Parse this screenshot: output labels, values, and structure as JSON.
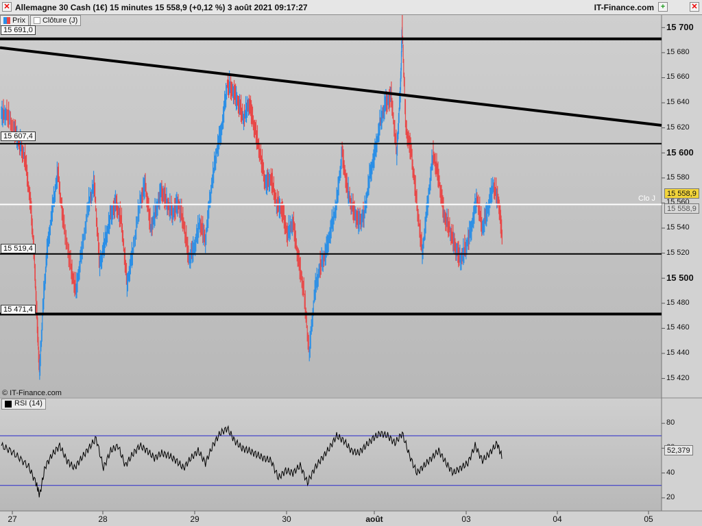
{
  "header": {
    "title": "Allemagne 30 Cash (1€) 15 minutes 15 558,9 (+0,12 %) 3 août 2021 09:17:27",
    "brand": "IT-Finance.com",
    "close_symbol": "✕",
    "add_symbol": "+"
  },
  "legend": [
    {
      "label": "Prix",
      "color": "#e03030"
    },
    {
      "label": "Clôture (J)",
      "color": "#ffffff"
    }
  ],
  "level_tags": [
    "15 691,0",
    "15 607,4",
    "15 519,4",
    "15 471,4"
  ],
  "closing_label": "Clo J",
  "last_price": "15 558,9",
  "close_price": "15 558,9",
  "copyright": "© IT-Finance.com",
  "rsi_label": "RSI (14)",
  "rsi_value": "52,379",
  "colors": {
    "background": "#c9c9c9",
    "up": "#2b8fe6",
    "down": "#e84848",
    "closing_line": "#ffffff",
    "rsi_bands": "#2828cc",
    "last_price_box": "#f2d43a"
  },
  "chart_data": {
    "type": "line",
    "price_axis": {
      "range": [
        15405,
        15710
      ],
      "ticks": [
        15420,
        15440,
        15460,
        15480,
        15500,
        15520,
        15540,
        15560,
        15580,
        15600,
        15620,
        15640,
        15660,
        15680,
        15700
      ],
      "tick_labels": [
        "15 420",
        "15 440",
        "15 460",
        "15 480",
        "15 500",
        "15 520",
        "15 540",
        "15 560",
        "15 580",
        "15 600",
        "15 620",
        "15 640",
        "15 660",
        "15 680",
        "15 700"
      ],
      "major": [
        "15 500",
        "15 600",
        "15 700"
      ]
    },
    "x_axis": {
      "labels": [
        "27",
        "28",
        "29",
        "30",
        "août",
        "03",
        "04",
        "05"
      ],
      "major": [
        "août"
      ]
    },
    "levels": [
      15691.0,
      15607.4,
      15519.4,
      15471.4
    ],
    "closing_level": 15558.9,
    "trendline": {
      "from": [
        0,
        15684
      ],
      "to": [
        1,
        15622
      ]
    },
    "price_series": [
      [
        0,
        15630
      ],
      [
        0.3,
        15632
      ],
      [
        0.7,
        15618
      ],
      [
        1,
        15608
      ],
      [
        1.3,
        15596
      ],
      [
        1.6,
        15560
      ],
      [
        1.8,
        15520
      ],
      [
        1.95,
        15470
      ],
      [
        2.1,
        15425
      ],
      [
        2.3,
        15480
      ],
      [
        2.5,
        15520
      ],
      [
        2.8,
        15555
      ],
      [
        3.1,
        15585
      ],
      [
        3.4,
        15545
      ],
      [
        3.8,
        15510
      ],
      [
        4.1,
        15490
      ],
      [
        4.4,
        15520
      ],
      [
        4.8,
        15560
      ],
      [
        5.1,
        15575
      ],
      [
        5.4,
        15510
      ],
      [
        5.7,
        15530
      ],
      [
        6.0,
        15550
      ],
      [
        6.3,
        15560
      ],
      [
        6.6,
        15545
      ],
      [
        6.9,
        15495
      ],
      [
        7.2,
        15520
      ],
      [
        7.6,
        15560
      ],
      [
        7.9,
        15575
      ],
      [
        8.2,
        15540
      ],
      [
        8.5,
        15555
      ],
      [
        8.8,
        15570
      ],
      [
        9.1,
        15560
      ],
      [
        9.4,
        15552
      ],
      [
        9.7,
        15560
      ],
      [
        10.0,
        15545
      ],
      [
        10.3,
        15515
      ],
      [
        10.6,
        15525
      ],
      [
        10.9,
        15545
      ],
      [
        11.2,
        15530
      ],
      [
        11.5,
        15570
      ],
      [
        11.8,
        15600
      ],
      [
        12.1,
        15620
      ],
      [
        12.4,
        15655
      ],
      [
        12.7,
        15650
      ],
      [
        13.0,
        15640
      ],
      [
        13.3,
        15628
      ],
      [
        13.6,
        15640
      ],
      [
        13.9,
        15620
      ],
      [
        14.2,
        15600
      ],
      [
        14.5,
        15575
      ],
      [
        14.8,
        15580
      ],
      [
        15.1,
        15560
      ],
      [
        15.4,
        15555
      ],
      [
        15.7,
        15535
      ],
      [
        16.0,
        15545
      ],
      [
        16.3,
        15515
      ],
      [
        16.6,
        15490
      ],
      [
        16.9,
        15440
      ],
      [
        17.2,
        15490
      ],
      [
        17.5,
        15510
      ],
      [
        17.8,
        15520
      ],
      [
        18.1,
        15540
      ],
      [
        18.4,
        15560
      ],
      [
        18.7,
        15600
      ],
      [
        19.0,
        15570
      ],
      [
        19.3,
        15555
      ],
      [
        19.6,
        15545
      ],
      [
        19.9,
        15550
      ],
      [
        20.2,
        15580
      ],
      [
        20.5,
        15600
      ],
      [
        20.8,
        15625
      ],
      [
        21.1,
        15640
      ],
      [
        21.4,
        15645
      ],
      [
        21.7,
        15600
      ],
      [
        21.9,
        15650
      ],
      [
        22.0,
        15700
      ],
      [
        22.2,
        15620
      ],
      [
        22.5,
        15600
      ],
      [
        22.8,
        15560
      ],
      [
        23.1,
        15520
      ],
      [
        23.4,
        15560
      ],
      [
        23.7,
        15600
      ],
      [
        24.0,
        15580
      ],
      [
        24.3,
        15550
      ],
      [
        24.6,
        15540
      ],
      [
        24.9,
        15525
      ],
      [
        25.2,
        15515
      ],
      [
        25.5,
        15525
      ],
      [
        25.8,
        15540
      ],
      [
        26.1,
        15565
      ],
      [
        26.4,
        15540
      ],
      [
        26.7,
        15555
      ],
      [
        27.0,
        15575
      ],
      [
        27.3,
        15560
      ],
      [
        27.5,
        15530
      ]
    ],
    "rsi": {
      "range": [
        10,
        90
      ],
      "ticks": [
        20,
        40,
        60,
        80
      ],
      "bands": [
        70,
        30
      ],
      "series": [
        [
          0,
          62
        ],
        [
          0.5,
          58
        ],
        [
          1.0,
          52
        ],
        [
          1.5,
          45
        ],
        [
          1.9,
          32
        ],
        [
          2.1,
          22
        ],
        [
          2.4,
          45
        ],
        [
          2.8,
          55
        ],
        [
          3.2,
          62
        ],
        [
          3.6,
          50
        ],
        [
          4.0,
          44
        ],
        [
          4.4,
          52
        ],
        [
          4.8,
          60
        ],
        [
          5.2,
          68
        ],
        [
          5.6,
          44
        ],
        [
          6.0,
          58
        ],
        [
          6.4,
          62
        ],
        [
          6.8,
          46
        ],
        [
          7.2,
          55
        ],
        [
          7.6,
          62
        ],
        [
          8.0,
          58
        ],
        [
          8.4,
          52
        ],
        [
          8.8,
          56
        ],
        [
          9.2,
          54
        ],
        [
          9.6,
          50
        ],
        [
          10.0,
          44
        ],
        [
          10.4,
          52
        ],
        [
          10.8,
          58
        ],
        [
          11.2,
          48
        ],
        [
          11.6,
          62
        ],
        [
          12.0,
          72
        ],
        [
          12.4,
          76
        ],
        [
          12.8,
          66
        ],
        [
          13.2,
          60
        ],
        [
          13.6,
          58
        ],
        [
          14.0,
          55
        ],
        [
          14.4,
          52
        ],
        [
          14.8,
          50
        ],
        [
          15.2,
          36
        ],
        [
          15.6,
          42
        ],
        [
          16.0,
          40
        ],
        [
          16.4,
          46
        ],
        [
          16.8,
          32
        ],
        [
          17.2,
          44
        ],
        [
          17.6,
          52
        ],
        [
          18.0,
          60
        ],
        [
          18.4,
          70
        ],
        [
          18.8,
          66
        ],
        [
          19.2,
          58
        ],
        [
          19.6,
          56
        ],
        [
          20.0,
          62
        ],
        [
          20.4,
          68
        ],
        [
          20.8,
          72
        ],
        [
          21.2,
          70
        ],
        [
          21.6,
          64
        ],
        [
          22.0,
          72
        ],
        [
          22.4,
          54
        ],
        [
          22.8,
          40
        ],
        [
          23.2,
          46
        ],
        [
          23.6,
          52
        ],
        [
          24.0,
          58
        ],
        [
          24.4,
          48
        ],
        [
          24.8,
          40
        ],
        [
          25.2,
          44
        ],
        [
          25.6,
          48
        ],
        [
          26.0,
          62
        ],
        [
          26.4,
          50
        ],
        [
          26.8,
          56
        ],
        [
          27.2,
          64
        ],
        [
          27.5,
          52
        ]
      ]
    }
  }
}
